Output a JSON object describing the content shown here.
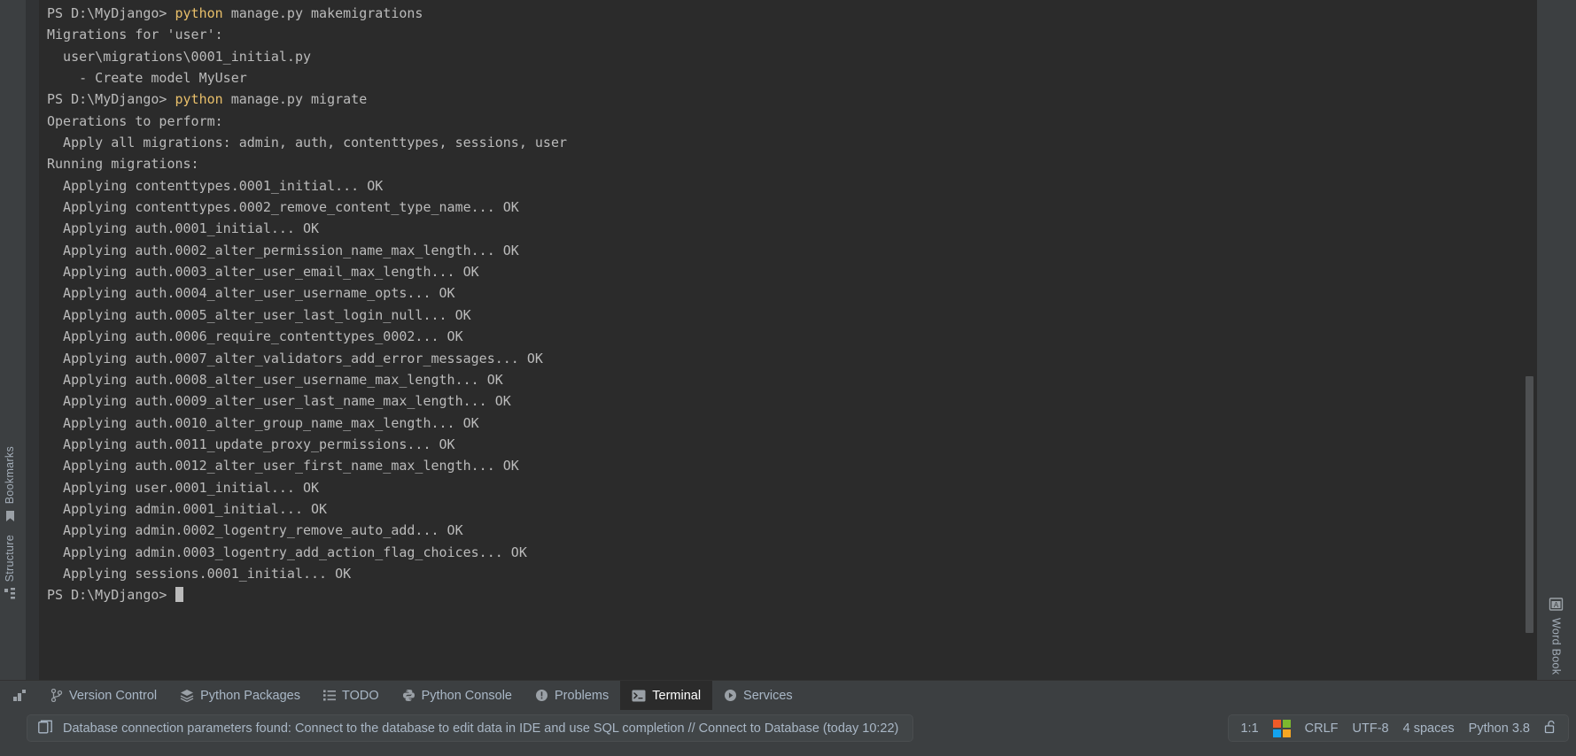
{
  "terminal": {
    "lines": [
      {
        "segments": [
          {
            "t": "PS D:\\MyDjango> ",
            "c": "plain"
          },
          {
            "t": "python",
            "c": "kw"
          },
          {
            "t": " manage.py makemigrations",
            "c": "plain"
          }
        ]
      },
      {
        "segments": [
          {
            "t": "Migrations for 'user':",
            "c": "plain"
          }
        ]
      },
      {
        "segments": [
          {
            "t": "  user\\migrations\\0001_initial.py",
            "c": "plain"
          }
        ]
      },
      {
        "segments": [
          {
            "t": "    - Create model MyUser",
            "c": "plain"
          }
        ]
      },
      {
        "segments": [
          {
            "t": "PS D:\\MyDjango> ",
            "c": "plain"
          },
          {
            "t": "python",
            "c": "kw"
          },
          {
            "t": " manage.py migrate",
            "c": "plain"
          }
        ]
      },
      {
        "segments": [
          {
            "t": "Operations to perform:",
            "c": "plain"
          }
        ]
      },
      {
        "segments": [
          {
            "t": "  Apply all migrations: admin, auth, contenttypes, sessions, user",
            "c": "plain"
          }
        ]
      },
      {
        "segments": [
          {
            "t": "Running migrations:",
            "c": "plain"
          }
        ]
      },
      {
        "segments": [
          {
            "t": "  Applying contenttypes.0001_initial... OK",
            "c": "plain"
          }
        ]
      },
      {
        "segments": [
          {
            "t": "  Applying contenttypes.0002_remove_content_type_name... OK",
            "c": "plain"
          }
        ]
      },
      {
        "segments": [
          {
            "t": "  Applying auth.0001_initial... OK",
            "c": "plain"
          }
        ]
      },
      {
        "segments": [
          {
            "t": "  Applying auth.0002_alter_permission_name_max_length... OK",
            "c": "plain"
          }
        ]
      },
      {
        "segments": [
          {
            "t": "  Applying auth.0003_alter_user_email_max_length... OK",
            "c": "plain"
          }
        ]
      },
      {
        "segments": [
          {
            "t": "  Applying auth.0004_alter_user_username_opts... OK",
            "c": "plain"
          }
        ]
      },
      {
        "segments": [
          {
            "t": "  Applying auth.0005_alter_user_last_login_null... OK",
            "c": "plain"
          }
        ]
      },
      {
        "segments": [
          {
            "t": "  Applying auth.0006_require_contenttypes_0002... OK",
            "c": "plain"
          }
        ]
      },
      {
        "segments": [
          {
            "t": "  Applying auth.0007_alter_validators_add_error_messages... OK",
            "c": "plain"
          }
        ]
      },
      {
        "segments": [
          {
            "t": "  Applying auth.0008_alter_user_username_max_length... OK",
            "c": "plain"
          }
        ]
      },
      {
        "segments": [
          {
            "t": "  Applying auth.0009_alter_user_last_name_max_length... OK",
            "c": "plain"
          }
        ]
      },
      {
        "segments": [
          {
            "t": "  Applying auth.0010_alter_group_name_max_length... OK",
            "c": "plain"
          }
        ]
      },
      {
        "segments": [
          {
            "t": "  Applying auth.0011_update_proxy_permissions... OK",
            "c": "plain"
          }
        ]
      },
      {
        "segments": [
          {
            "t": "  Applying auth.0012_alter_user_first_name_max_length... OK",
            "c": "plain"
          }
        ]
      },
      {
        "segments": [
          {
            "t": "  Applying user.0001_initial... OK",
            "c": "plain"
          }
        ]
      },
      {
        "segments": [
          {
            "t": "  Applying admin.0001_initial... OK",
            "c": "plain"
          }
        ]
      },
      {
        "segments": [
          {
            "t": "  Applying admin.0002_logentry_remove_auto_add... OK",
            "c": "plain"
          }
        ]
      },
      {
        "segments": [
          {
            "t": "  Applying admin.0003_logentry_add_action_flag_choices... OK",
            "c": "plain"
          }
        ]
      },
      {
        "segments": [
          {
            "t": "  Applying sessions.0001_initial... OK",
            "c": "plain"
          }
        ]
      },
      {
        "segments": [
          {
            "t": "PS D:\\MyDjango> ",
            "c": "plain"
          },
          {
            "t": "",
            "c": "cursor"
          }
        ]
      }
    ],
    "colors": {
      "background": "#2b2b2b",
      "text": "#bbbbbb",
      "keyword": "#e8bf6a"
    }
  },
  "left_strip": {
    "items": [
      {
        "label": "Bookmarks",
        "icon": "bookmark-icon"
      },
      {
        "label": "Structure",
        "icon": "structure-icon"
      }
    ]
  },
  "right_strip": {
    "items": [
      {
        "label": "Word Book",
        "icon": "book-icon"
      }
    ]
  },
  "tabbar": {
    "more_icon": "more-tool-windows-icon",
    "tabs": [
      {
        "label": "Version Control",
        "icon": "branch-icon",
        "active": false
      },
      {
        "label": "Python Packages",
        "icon": "stack-icon",
        "active": false
      },
      {
        "label": "TODO",
        "icon": "list-icon",
        "active": false
      },
      {
        "label": "Python Console",
        "icon": "python-icon",
        "active": false
      },
      {
        "label": "Problems",
        "icon": "warning-circle-icon",
        "active": false
      },
      {
        "label": "Terminal",
        "icon": "console-icon",
        "active": true
      },
      {
        "label": "Services",
        "icon": "play-circle-icon",
        "active": false
      }
    ]
  },
  "statusbar": {
    "message_icon": "database-icon",
    "message": "Database connection parameters found: Connect to the database to edit data in IDE and use SQL completion // Connect to Database (today 10:22)",
    "caret_position": "1:1",
    "os_icon": "windows-logo-icon",
    "os_icon_colors": [
      "#f05a28",
      "#7cb82f",
      "#13a3f0",
      "#f5a623"
    ],
    "line_separator": "CRLF",
    "encoding": "UTF-8",
    "indent": "4 spaces",
    "interpreter": "Python 3.8",
    "lock_icon": "unlocked-lock-icon"
  }
}
